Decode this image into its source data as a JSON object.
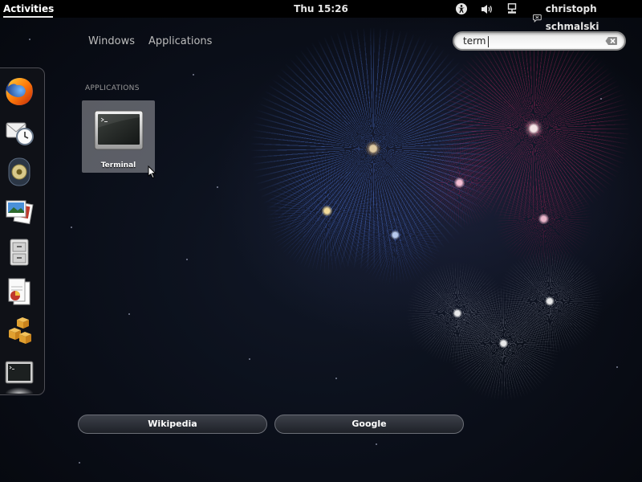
{
  "topbar": {
    "activities_label": "Activities",
    "clock": "Thu 15:26",
    "user_name": "christoph schmalski"
  },
  "overview": {
    "tabs": [
      {
        "label": "Windows"
      },
      {
        "label": "Applications"
      }
    ],
    "search": {
      "value": "term"
    }
  },
  "results": {
    "section_heading": "APPLICATIONS",
    "items": [
      {
        "label": "Terminal",
        "icon": "terminal-icon"
      }
    ]
  },
  "dash": {
    "items": [
      {
        "icon": "firefox-icon"
      },
      {
        "icon": "mail-clock-icon"
      },
      {
        "icon": "speaker-icon"
      },
      {
        "icon": "photos-icon"
      },
      {
        "icon": "file-cabinet-icon"
      },
      {
        "icon": "documents-icon"
      },
      {
        "icon": "software-boxes-icon"
      },
      {
        "icon": "terminal-icon"
      }
    ]
  },
  "search_providers": [
    {
      "label": "Wikipedia"
    },
    {
      "label": "Google"
    }
  ],
  "colors": {
    "topbar_bg": "#000000",
    "tile_highlight": "#cdcdd2",
    "firework_blue": "#5a8cff",
    "firework_red": "#c82864"
  }
}
